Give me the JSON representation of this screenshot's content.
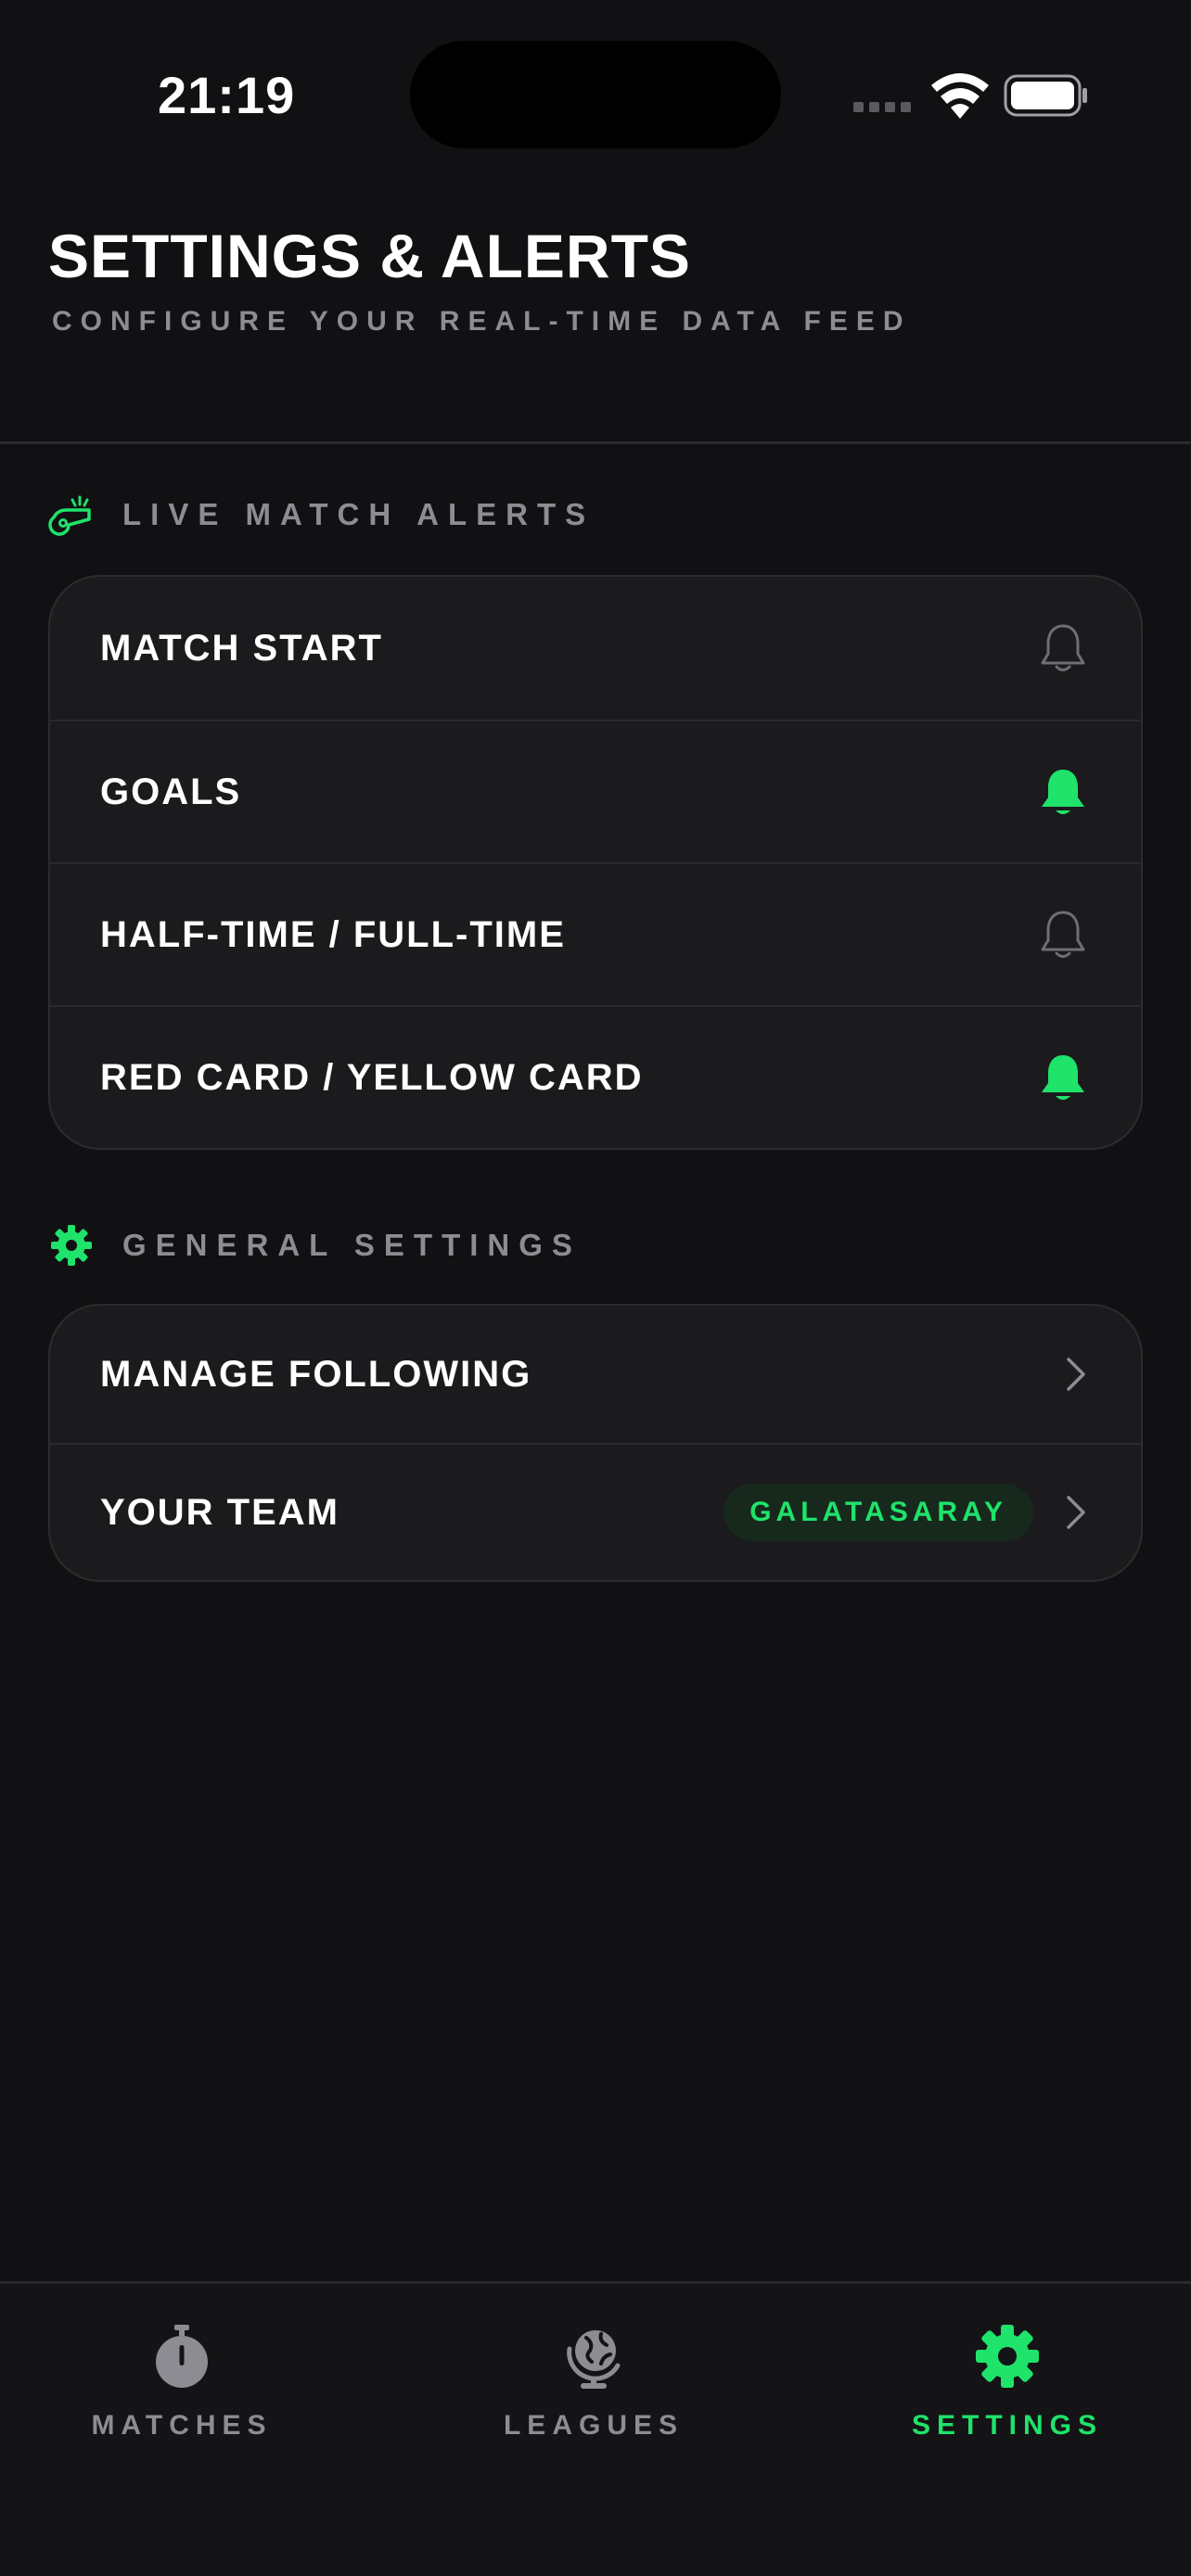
{
  "status_bar": {
    "time": "21:19"
  },
  "header": {
    "title": "SETTINGS & ALERTS",
    "subtitle": "CONFIGURE YOUR REAL-TIME DATA FEED"
  },
  "sections": {
    "alerts": {
      "title": "LIVE MATCH ALERTS",
      "icon": "whistle-icon",
      "items": [
        {
          "label": "MATCH START",
          "enabled": false
        },
        {
          "label": "GOALS",
          "enabled": true
        },
        {
          "label": "HALF-TIME / FULL-TIME",
          "enabled": false
        },
        {
          "label": "RED CARD / YELLOW CARD",
          "enabled": true
        }
      ]
    },
    "general": {
      "title": "GENERAL SETTINGS",
      "icon": "gear-icon",
      "items": [
        {
          "label": "MANAGE FOLLOWING"
        },
        {
          "label": "YOUR TEAM",
          "badge": "GALATASARAY"
        }
      ]
    }
  },
  "tabs": [
    {
      "label": "MATCHES",
      "icon": "stopwatch-icon",
      "active": false
    },
    {
      "label": "LEAGUES",
      "icon": "globe-icon",
      "active": false
    },
    {
      "label": "SETTINGS",
      "icon": "gear-icon",
      "active": true
    }
  ],
  "colors": {
    "background": "#111113",
    "card": "#1b1b1d",
    "accent": "#1fe36a",
    "muted": "#8c8c92",
    "bell_off": "#6e6e73"
  }
}
